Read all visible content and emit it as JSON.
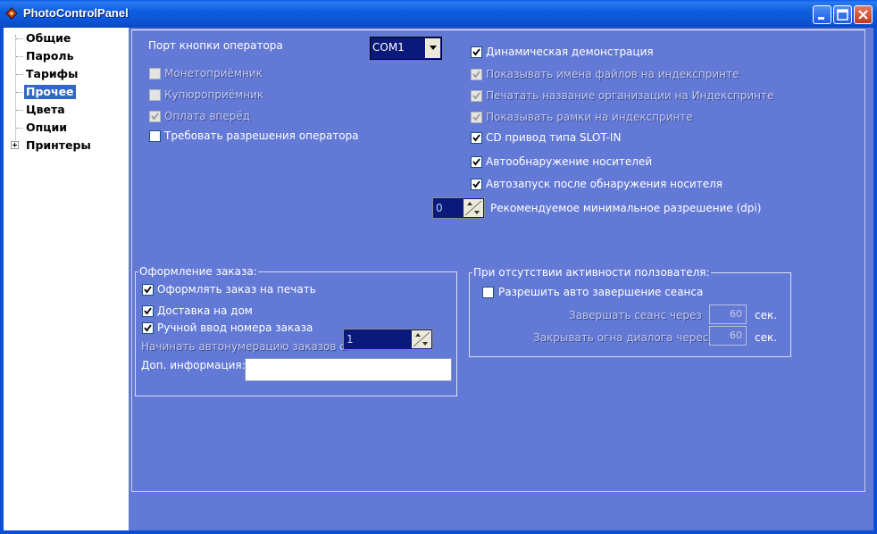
{
  "window": {
    "title": "PhotoControlPanel"
  },
  "tree": [
    {
      "label": "Общие"
    },
    {
      "label": "Пароль"
    },
    {
      "label": "Тарифы"
    },
    {
      "label": "Прочее",
      "selected": true
    },
    {
      "label": "Цвета"
    },
    {
      "label": "Опции"
    },
    {
      "label": "Принтеры",
      "expandable": true
    }
  ],
  "left": {
    "port_label": "Порт кнопки оператора",
    "port_value": "COM1",
    "checks": [
      {
        "label": "Монетоприёмник",
        "checked": false,
        "enabled": false
      },
      {
        "label": "Купюроприёмник",
        "checked": false,
        "enabled": false
      },
      {
        "label": "Оплата вперёд",
        "checked": true,
        "enabled": false
      },
      {
        "label": "Требовать разрешения оператора",
        "checked": false,
        "enabled": true
      }
    ]
  },
  "right": {
    "checks": [
      {
        "label": "Динамическая демонстрация",
        "checked": true,
        "enabled": true
      },
      {
        "label": "Показывать имена файлов на индекспринте",
        "checked": true,
        "enabled": false
      },
      {
        "label": "Печатать название организации на Индекспринте",
        "checked": true,
        "enabled": false
      },
      {
        "label": "Показывать рамки на индекспринте",
        "checked": true,
        "enabled": false
      },
      {
        "label": "CD привод типа SLOT-IN",
        "checked": true,
        "enabled": true
      },
      {
        "label": "Автообнаружение носителей",
        "checked": true,
        "enabled": true
      },
      {
        "label": "Автозапуск после обнаружения носителя",
        "checked": true,
        "enabled": true
      }
    ],
    "dpi_value": "0",
    "dpi_label": "Рекомендуемое минимальное разрешение (dpi)"
  },
  "order": {
    "title": "Оформление заказа:",
    "checks": [
      {
        "label": "Оформлять заказ на печать",
        "checked": true
      },
      {
        "label": "Доставка на дом",
        "checked": true
      },
      {
        "label": "Ручной ввод номера заказа",
        "checked": true
      }
    ],
    "autonum_label": "Начинать автонумерацию заказов с:",
    "autonum_value": "1",
    "info_label": "Доп. информация:",
    "info_value": ""
  },
  "idle": {
    "title": "При отсутствии активности ползователя:",
    "check": {
      "label": "Разрешить авто завершение сеанса",
      "checked": false
    },
    "end_label": "Завершать сеанс через",
    "end_value": "60",
    "end_unit": "сек.",
    "close_label": "Закрывать огна диалога черес",
    "close_value": "60",
    "close_unit": "сек."
  },
  "colors": {
    "background": "#6379d6",
    "titlebar": "#0a5fe8",
    "selection": "#316ac5",
    "field": "#0a1a7a"
  }
}
